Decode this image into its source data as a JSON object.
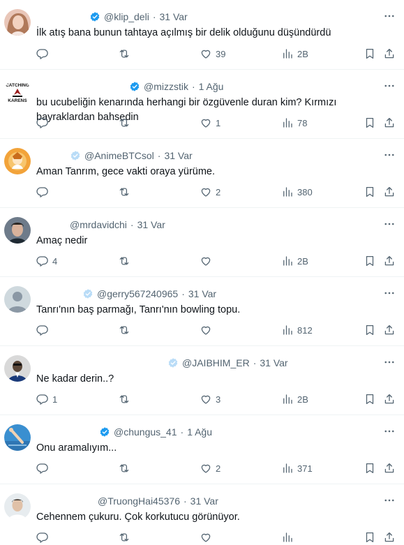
{
  "colors": {
    "text": "#0f1419",
    "muted": "#536471",
    "border": "#eff3f4",
    "verified_blue": "#1d9bf0",
    "verified_light": "#b9dcf7"
  },
  "tweets": [
    {
      "handle": "@klip_deli",
      "date": "31 Var",
      "badge": "blue",
      "text": "İlk atış bana bunun tahtaya açılmış bir delik olduğunu düşündürdü",
      "replies": "",
      "retweets": "",
      "likes": "39",
      "views": "2B",
      "avatar": "woman-avatar",
      "header_right": 258
    },
    {
      "handle": "@mizzstik",
      "date": "1 Ağu",
      "badge": "blue",
      "text": "bu ucubeliğin kenarında herhangi bir özgüvenle duran kim? Kırmızı bayraklardan bahsedin",
      "replies": "",
      "retweets": "",
      "likes": "1",
      "views": "78",
      "avatar": "catching-karens-logo",
      "header_right": 250
    },
    {
      "handle": "@AnimeBTCsol",
      "date": "31 Var",
      "badge": "light",
      "text": "Aman Tanrım, gece vakti oraya yürüme.",
      "replies": "",
      "retweets": "",
      "likes": "2",
      "views": "380",
      "avatar": "anime-avatar",
      "header_right": 293
    },
    {
      "handle": "@mrdavidchi",
      "date": "31 Var",
      "badge": "none",
      "text": "Amaç nedir",
      "replies": "4",
      "retweets": "",
      "likes": "",
      "views": "2B",
      "avatar": "man-avatar",
      "header_right": 315
    },
    {
      "handle": "@gerry567240965",
      "date": "31 Var",
      "badge": "light",
      "text": "Tanrı'nın baş parmağı, Tanrı'nın bowling topu.",
      "replies": "",
      "retweets": "",
      "likes": "",
      "views": "812",
      "avatar": "default-avatar",
      "header_right": 254
    },
    {
      "handle": "@JAIBHIM_ER",
      "date": "31 Var",
      "badge": "light",
      "text": "Ne kadar derin..?",
      "replies": "1",
      "retweets": "",
      "likes": "3",
      "views": "2B",
      "avatar": "portrait-avatar",
      "header_right": 164
    },
    {
      "handle": "@chungus_41",
      "date": "1 Ağu",
      "badge": "blue",
      "text": "Onu aramalıyım...",
      "replies": "",
      "retweets": "",
      "likes": "2",
      "views": "371",
      "avatar": "diver-avatar",
      "header_right": 271
    },
    {
      "handle": "@TruongHai45376",
      "date": "31 Var",
      "badge": "none",
      "text": "Cehennem çukuru. Çok korkutucu görünüyor.",
      "replies": "",
      "retweets": "",
      "likes": "",
      "views": "",
      "avatar": "man2-avatar",
      "header_right": 235
    }
  ]
}
